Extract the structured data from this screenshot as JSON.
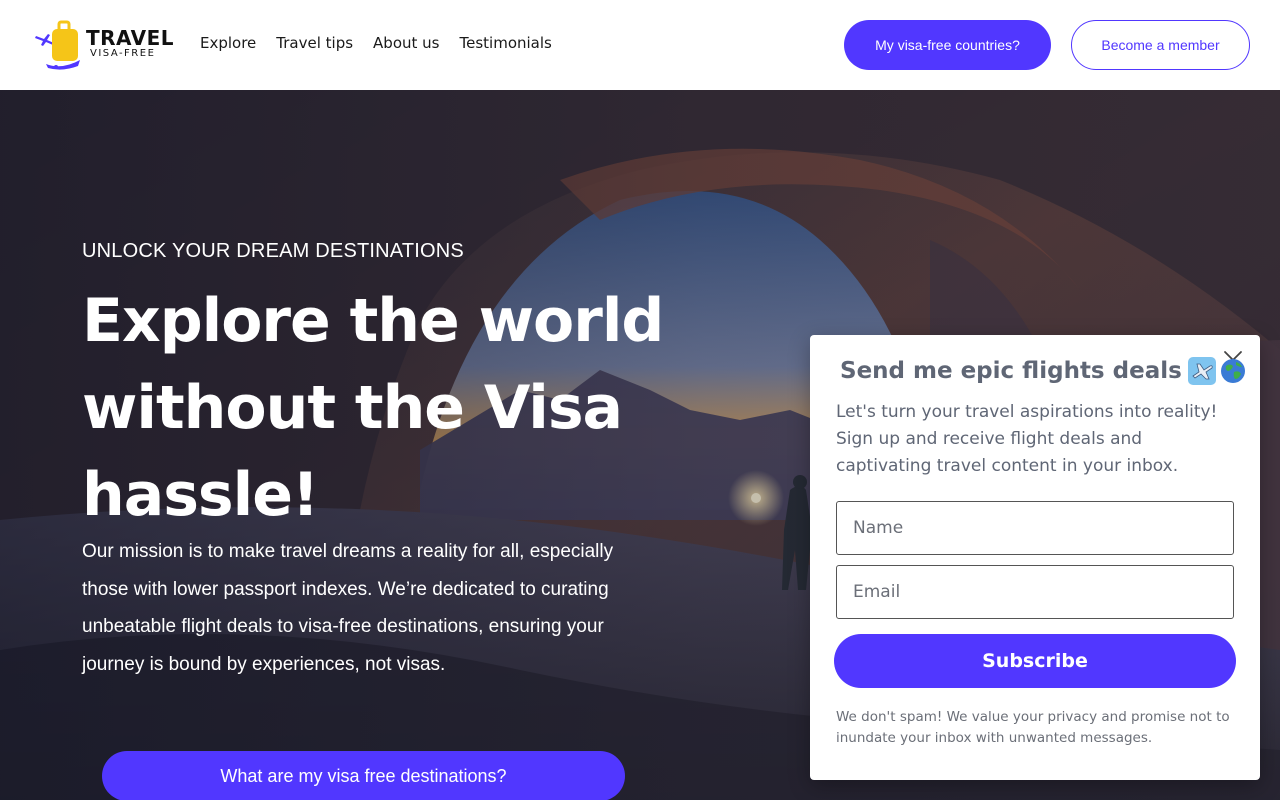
{
  "brand": {
    "name_top": "TRAVEL",
    "name_bottom": "VISA-FREE",
    "colors": {
      "accent": "#5137ff",
      "suitcase": "#f5c518"
    }
  },
  "nav": {
    "items": [
      {
        "label": "Explore"
      },
      {
        "label": "Travel tips"
      },
      {
        "label": "About us"
      },
      {
        "label": "Testimonials"
      }
    ]
  },
  "header_actions": {
    "primary_label": "My visa-free countries?",
    "secondary_label": "Become a member"
  },
  "hero": {
    "kicker": "UNLOCK YOUR DREAM DESTINATIONS",
    "headline": "Explore the world without the Visa hassle!",
    "mission": "Our mission is to make travel dreams a reality for all, especially those with lower passport indexes. We’re dedicated to curating unbeatable flight deals to visa-free destinations, ensuring your journey is bound by experiences, not visas.",
    "cta_label": "What are my visa free destinations?"
  },
  "popup": {
    "title": "Send me epic flights deals",
    "title_icons": [
      "airplane-icon",
      "globe-icon"
    ],
    "description": "Let's turn your travel aspirations into reality! Sign up and receive flight deals and captivating travel content in your inbox.",
    "name_placeholder": "Name",
    "email_placeholder": "Email",
    "name_value": "",
    "email_value": "",
    "submit_label": "Subscribe",
    "privacy_note": "We don't spam! We value your privacy and promise not to inundate your inbox with unwanted messages."
  }
}
